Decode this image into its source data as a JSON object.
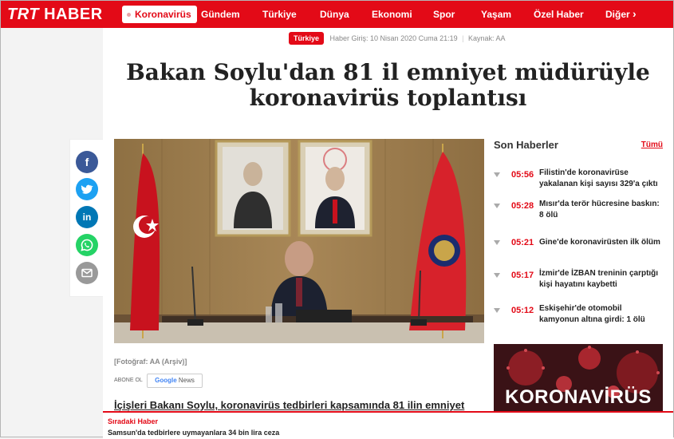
{
  "brand": {
    "logo_trt": "TRT",
    "logo_haber": "HABER"
  },
  "nav": {
    "items": [
      {
        "label": "Koronavirüs",
        "active": true
      },
      {
        "label": "Gündem"
      },
      {
        "label": "Türkiye"
      },
      {
        "label": "Dünya"
      },
      {
        "label": "Ekonomi"
      },
      {
        "label": "Spor"
      },
      {
        "label": "Yaşam"
      },
      {
        "label": "Özel Haber"
      },
      {
        "label": "Diğer"
      }
    ],
    "more_icon": "chevron-right-icon"
  },
  "article": {
    "category": "Türkiye",
    "published": "Haber Giriş: 10 Nisan 2020 Cuma 21:19",
    "source": "Kaynak: AA",
    "title_line1": "Bakan Soylu'dan 81 il emniyet müdürüyle",
    "title_line2": "koronavirüs toplantısı",
    "photo_caption": "[Fotoğraf: AA (Arşiv)]",
    "follow_label": "ABONE OL",
    "gnews_google": "Google",
    "gnews_news": "News",
    "lead": "İçişleri Bakanı Soylu, koronavirüs tedbirleri kapsamında 81 ilin emniyet"
  },
  "share": {
    "facebook": "f",
    "twitter": "t",
    "linkedin": "in",
    "whatsapp": "w",
    "email": "e"
  },
  "sidebar": {
    "title": "Son Haberler",
    "all_label": "Tümü",
    "items": [
      {
        "time": "05:56",
        "text": "Filistin'de koronavirüse yakalanan kişi sayısı 329'a çıktı"
      },
      {
        "time": "05:28",
        "text": "Mısır'da terör hücresine baskın: 8 ölü"
      },
      {
        "time": "05:21",
        "text": "Gine'de koronavirüsten ilk ölüm"
      },
      {
        "time": "05:17",
        "text": "İzmir'de İZBAN treninin çarptığı kişi hayatını kaybetti"
      },
      {
        "time": "05:12",
        "text": "Eskişehir'de otomobil kamyonun altına girdi: 1 ölü"
      }
    ]
  },
  "promo": {
    "text": "KORONAVİRÜS"
  },
  "next": {
    "label": "Sıradaki Haber",
    "title": "Samsun'da tedbirlere uymayanlara 34 bin lira ceza"
  },
  "colors": {
    "brand_red": "#e30a17",
    "facebook": "#3b5998",
    "twitter": "#1da1f2",
    "linkedin": "#0077b5",
    "whatsapp": "#25d366",
    "email": "#999999"
  }
}
